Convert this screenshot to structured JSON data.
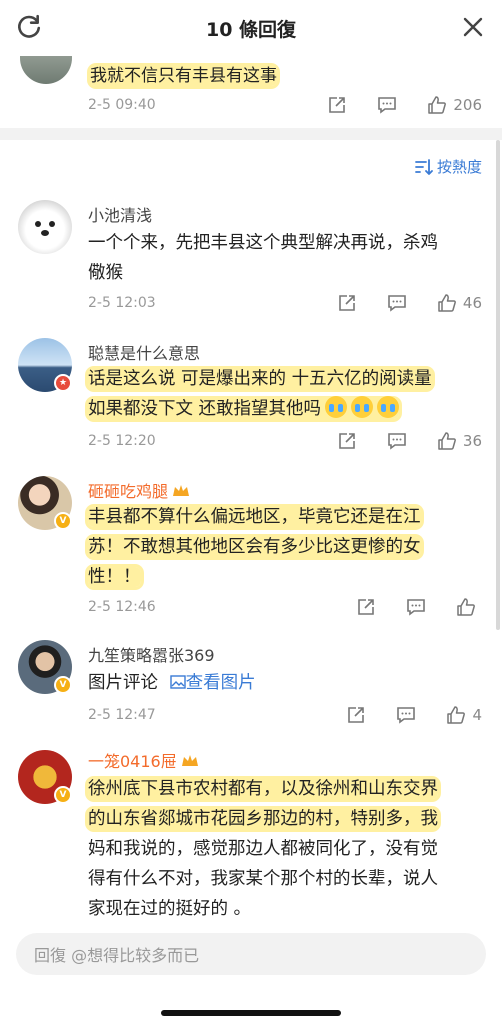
{
  "header": {
    "title": "10 條回復"
  },
  "top_comment": {
    "text": "我就不信只有丰县有这事",
    "time": "2-5 09:40",
    "likes": "206"
  },
  "sort": {
    "label": "按熱度"
  },
  "comments": [
    {
      "name": "小池清浅",
      "lines": [
        "一个个来，先把丰县这个典型解决再说，杀鸡",
        "儆猴"
      ],
      "time": "2-5 12:03",
      "likes": "46"
    },
    {
      "name": "聪慧是什么意思",
      "lines": [
        "话是这么说 可是爆出来的 十五六亿的阅读量",
        "如果都没下文 还敢指望其他吗"
      ],
      "time": "2-5 12:20",
      "likes": "36"
    },
    {
      "name": "砸砸吃鸡腿",
      "lines": [
        "丰县都不算什么偏远地区，毕竟它还是在江",
        "苏！不敢想其他地区会有多少比这更惨的女",
        "性！！"
      ],
      "time": "2-5 12:46",
      "likes": ""
    },
    {
      "name": "九笙策略嚣张369",
      "text_prefix": "图片评论",
      "link": "查看图片",
      "time": "2-5 12:47",
      "likes": "4"
    },
    {
      "name": "一笼0416屉",
      "lines": [
        "徐州底下县市农村都有，以及徐州和山东交界",
        "的山东省郯城市花园乡那边的村，特别多，我",
        "妈和我说的，感觉那边人都被同化了，没有觉",
        "得有什么不对，我家某个那个村的长辈，说人",
        "家现在过的挺好的 。"
      ]
    }
  ],
  "footer": {
    "reply_placeholder": "回復 @想得比较多而已"
  },
  "colors": {
    "highlight": "#ffeb82",
    "link": "#3a7bd5",
    "vip_name": "#f36b2b"
  }
}
